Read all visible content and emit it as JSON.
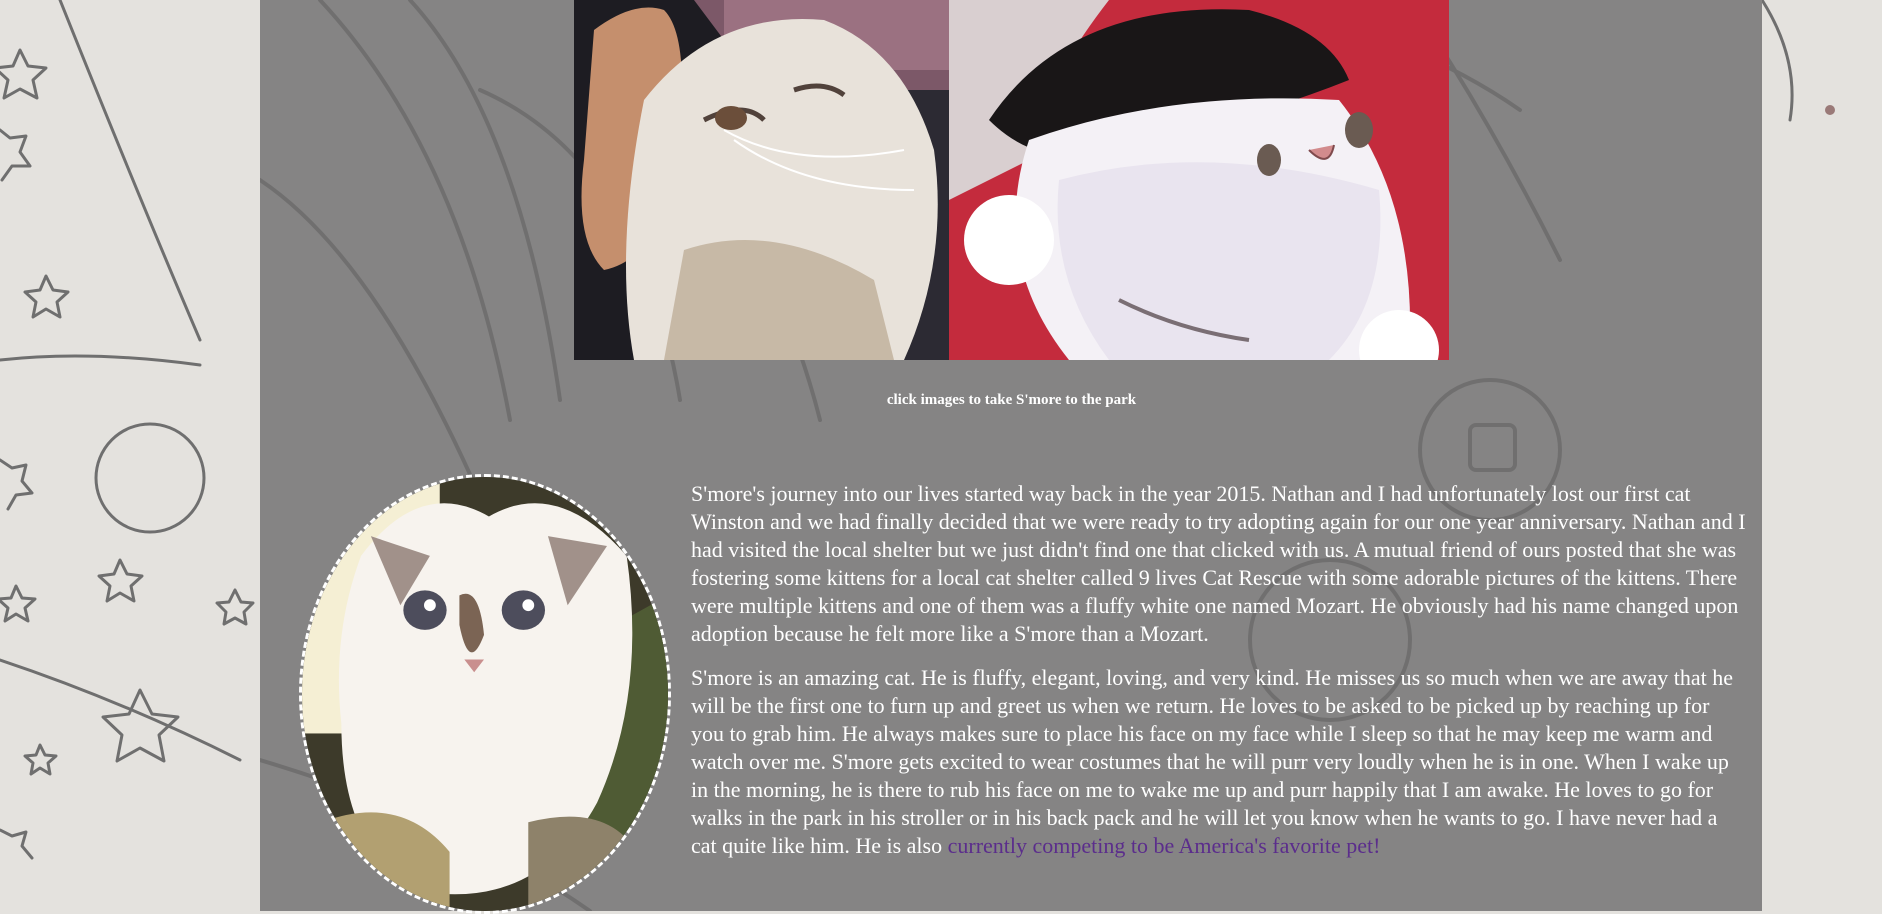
{
  "gallery": {
    "left_photo_alt": "S'more being scratched under the chin",
    "right_photo_alt": "S'more in a red and black costume hat",
    "caption": "click images to take S'more to the park"
  },
  "profile": {
    "oval_photo_alt": "S'more as a kitten"
  },
  "story": {
    "paragraph1": "S'more's journey into our lives started way back in the year 2015. Nathan and I had unfortunately lost our first cat Winston and we had finally decided that we were ready to try adopting again for our one year anniversary. Nathan and I had visited the local shelter but we just didn't find one that clicked with us. A mutual friend of ours posted that she was fostering some kittens for a local cat shelter called 9 lives Cat Rescue with some adorable pictures of the kittens. There were multiple kittens and one of them was a fluffy white one named Mozart. He obviously had his name changed upon adoption because he felt more like a S'more than a Mozart.",
    "paragraph2": "S'more is an amazing cat. He is fluffy, elegant, loving, and very kind. He misses us so much when we are away that he will be the first one to furn up and greet us when we return. He loves to be asked to be picked up by reaching up for you to grab him. He always makes sure to place his face on my face while I sleep so that he may keep me warm and watch over me. S'more gets excited to wear costumes that he will purr very loudly when he is in one. When I wake up in the morning, he is there to rub his face on me to wake me up and purr happily that I am awake. He loves to go for walks in the park in his stroller or in his back pack and he will let you know when he wants to go. I have never had a cat quite like him. He is also ",
    "link_text": "currently competing to be America's favorite pet!"
  },
  "colors": {
    "page_background": "#e4e2de",
    "panel_background": "#858484",
    "text": "#ffffff",
    "link": "#5b2d8c"
  }
}
